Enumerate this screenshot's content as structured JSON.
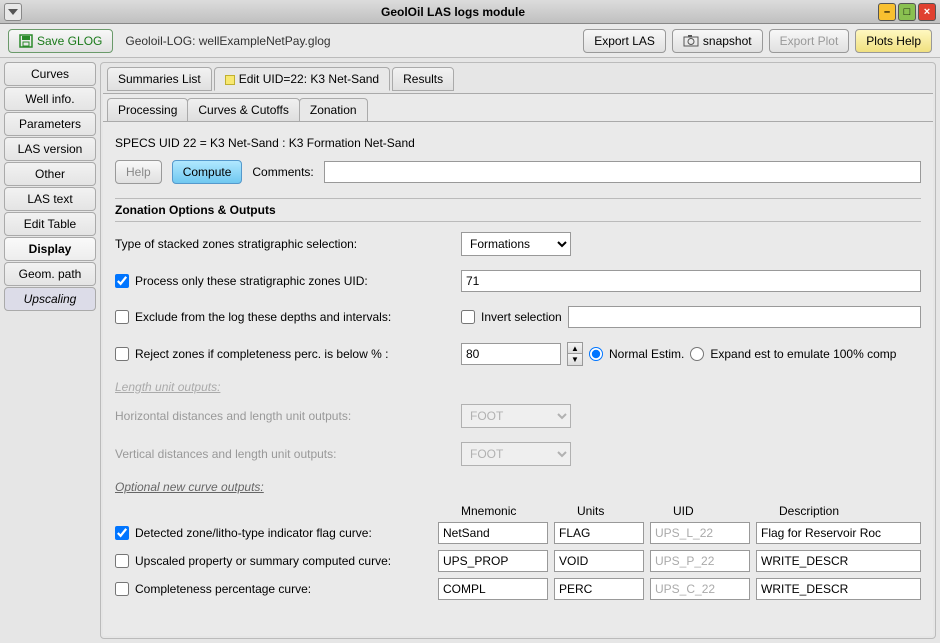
{
  "window": {
    "title": "GeolOil LAS logs module"
  },
  "toolbar": {
    "save_glog": "Save GLOG",
    "filename": "Geoloil-LOG: wellExampleNetPay.glog",
    "export_las": "Export LAS",
    "snapshot": "snapshot",
    "export_plot": "Export Plot",
    "plots_help": "Plots Help"
  },
  "sidetabs": [
    "Curves",
    "Well info.",
    "Parameters",
    "LAS version",
    "Other",
    "LAS text",
    "Edit Table",
    "Display",
    "Geom. path",
    "Upscaling"
  ],
  "sidetab_active": "Display",
  "sidetab_selected": "Upscaling",
  "toptabs": {
    "summaries": "Summaries List",
    "edit": "Edit UID=22: K3 Net-Sand",
    "results": "Results"
  },
  "subtabs": [
    "Processing",
    "Curves & Cutoffs",
    "Zonation"
  ],
  "subtab_active": "Zonation",
  "spec": "SPECS UID 22 = K3 Net-Sand : K3 Formation Net-Sand",
  "btns": {
    "help": "Help",
    "compute": "Compute",
    "comments_label": "Comments:"
  },
  "comments_value": "",
  "section_title": "Zonation Options & Outputs",
  "rows": {
    "type_label": "Type of stacked zones stratigraphic selection:",
    "type_value": "Formations",
    "process_only_label": "Process only these stratigraphic zones UID:",
    "process_only_checked": true,
    "process_only_value": "71",
    "exclude_label": "Exclude from the log these depths and intervals:",
    "exclude_checked": false,
    "invert_label": "Invert selection",
    "invert_checked": false,
    "invert_value": "",
    "reject_label": "Reject zones if completeness perc. is below % :",
    "reject_checked": false,
    "reject_value": "80",
    "normal_label": "Normal Estim.",
    "expand_label": "Expand est to emulate 100% comp"
  },
  "length_section": "Length unit outputs:",
  "horiz_label": "Horizontal distances and length unit outputs:",
  "horiz_value": "FOOT",
  "vert_label": "Vertical distances and length unit outputs:",
  "vert_value": "FOOT",
  "optional_section": "Optional new curve outputs:",
  "cols": {
    "c1": "Mnemonic",
    "c2": "Units",
    "c3": "UID",
    "c4": "Description"
  },
  "curves": [
    {
      "checked": true,
      "label": "Detected zone/litho-type indicator flag curve:",
      "mnemonic": "NetSand",
      "units": "FLAG",
      "uid": "UPS_L_22",
      "desc": "Flag for Reservoir Roc"
    },
    {
      "checked": false,
      "label": "Upscaled property or summary computed curve:",
      "mnemonic": "UPS_PROP",
      "units": "VOID",
      "uid": "UPS_P_22",
      "desc": "WRITE_DESCR"
    },
    {
      "checked": false,
      "label": "Completeness percentage curve:",
      "mnemonic": "COMPL",
      "units": "PERC",
      "uid": "UPS_C_22",
      "desc": "WRITE_DESCR"
    }
  ]
}
